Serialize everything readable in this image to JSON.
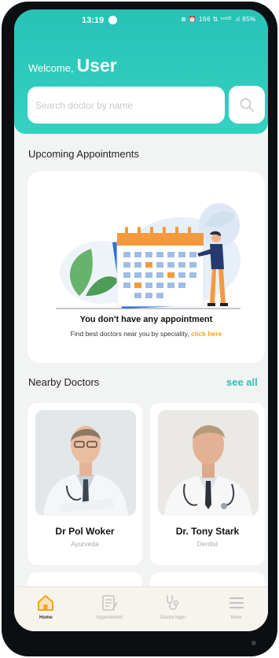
{
  "status_bar": {
    "time": "13:19",
    "right_text": "⊗ ⏰ 166 ⇅ ᵛᵒˡᵗᴱ .ıl 85%",
    "battery": "85%"
  },
  "header": {
    "welcome_prefix": "Welcome,",
    "welcome_user": "User",
    "accent": "#2ec6b8"
  },
  "search": {
    "placeholder": "Search doctor by name",
    "button_icon": "search-icon"
  },
  "appointments": {
    "title": "Upcoming Appointments",
    "empty_message": "You don't have any appointment",
    "hint_prefix": "Find best doctors near you by speciality,",
    "hint_link": "click here",
    "illustration_icon": "calendar-illustration-icon"
  },
  "nearby": {
    "title": "Nearby Doctors",
    "see_all": "see all",
    "doctors": [
      {
        "name": "Dr Pol Woker",
        "speciality": "Ayurveda"
      },
      {
        "name": "Dr. Tony Stark",
        "speciality": "Dentist"
      }
    ]
  },
  "nav": {
    "items": [
      {
        "label": "Home",
        "icon": "home-icon",
        "active": true
      },
      {
        "label": "Appointment",
        "icon": "clipboard-icon",
        "active": false
      },
      {
        "label": "Doctor login",
        "icon": "stethoscope-icon",
        "active": false
      },
      {
        "label": "More",
        "icon": "menu-icon",
        "active": false
      }
    ]
  },
  "colors": {
    "teal": "#2ec6b8",
    "link": "#f5a60a",
    "nav_active": "#f5a60a"
  }
}
